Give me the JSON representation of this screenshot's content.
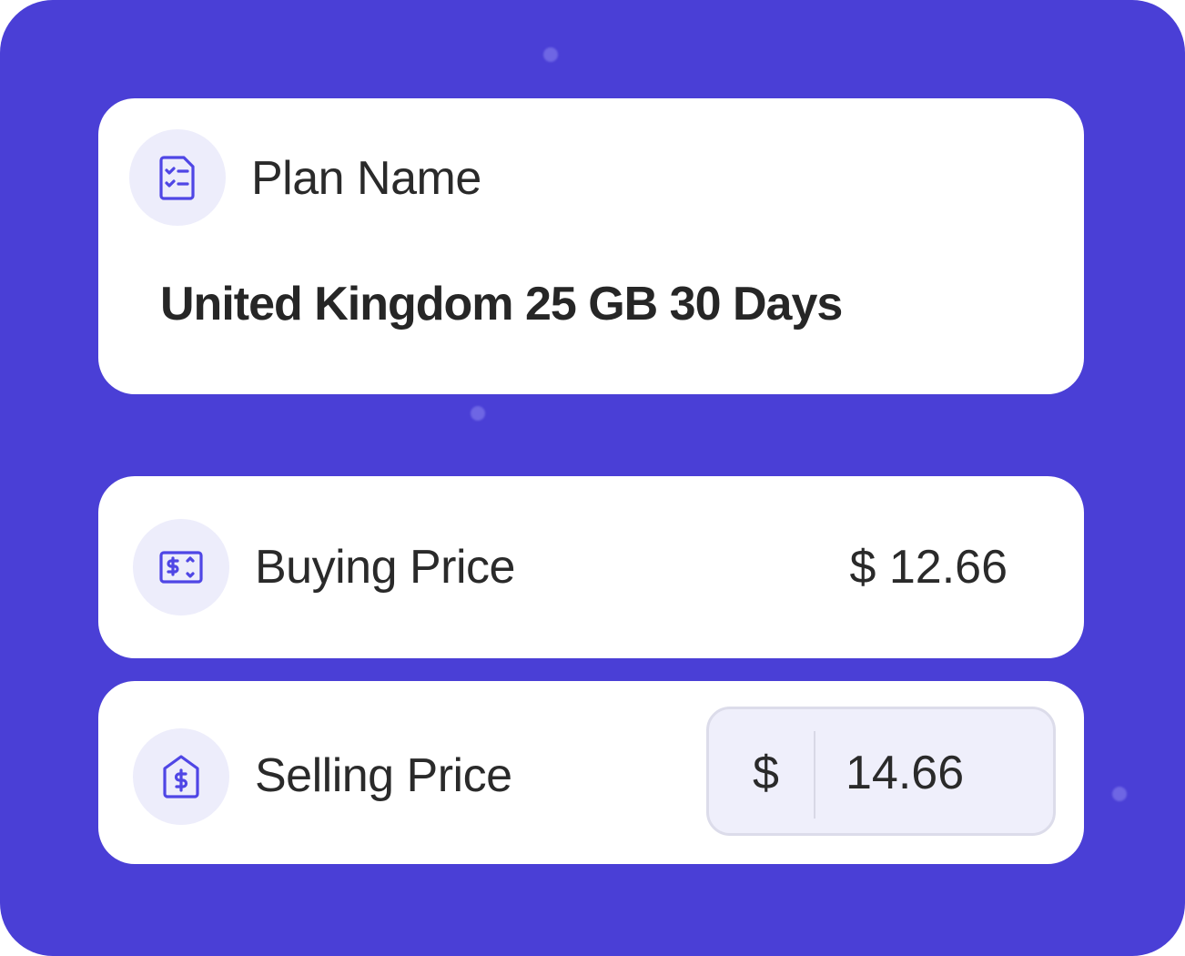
{
  "colors": {
    "background": "#4a3fd6",
    "card": "#ffffff",
    "icon_accent": "#4f46e5",
    "icon_circle": "#ededfb",
    "input_bg": "#efeffb"
  },
  "plan": {
    "icon": "checklist-document-icon",
    "label": "Plan Name",
    "value": "United Kingdom 25 GB 30 Days"
  },
  "buying": {
    "icon": "money-bill-icon",
    "label": "Buying Price",
    "value": "$ 12.66"
  },
  "selling": {
    "icon": "price-tag-dollar-icon",
    "label": "Selling Price",
    "currency": "$",
    "value": "14.66"
  }
}
